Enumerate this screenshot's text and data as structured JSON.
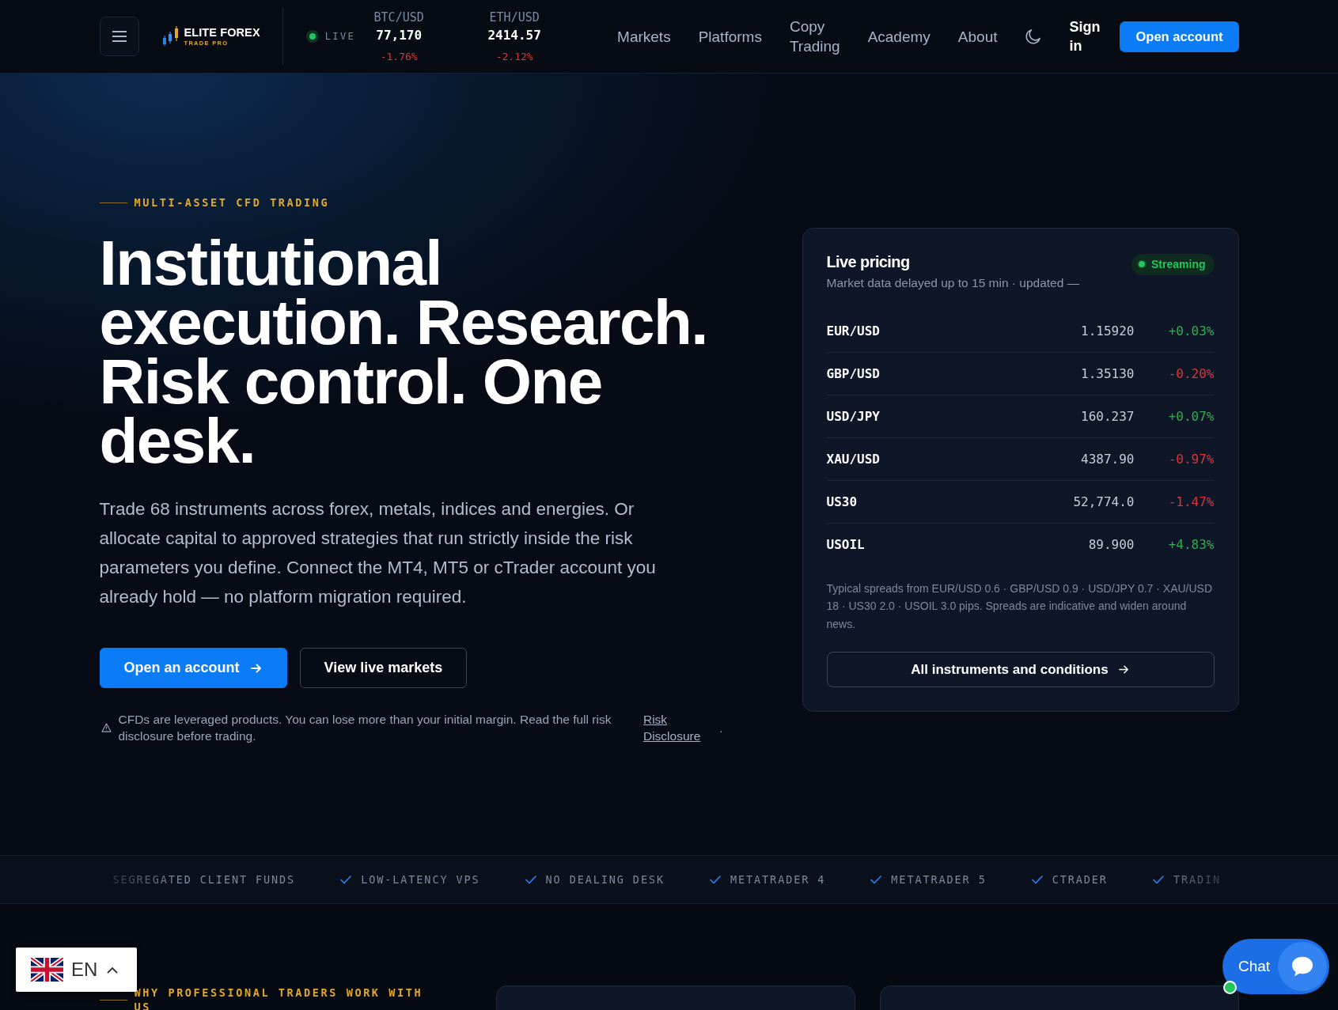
{
  "header": {
    "logo": {
      "name": "ELITE FOREX",
      "tagline": "TRADE PRO"
    },
    "live_label": "LIVE",
    "tickers": [
      {
        "symbol": "BTC/USD",
        "price": "77,170",
        "change": "-1.76%",
        "color": "#dd3535"
      },
      {
        "symbol": "ETH/USD",
        "price": "2414.57",
        "change": "-2.12%",
        "color": "#dd3535"
      }
    ],
    "nav": [
      "Markets",
      "Platforms",
      "Copy Trading",
      "Academy",
      "About"
    ],
    "sign_in": "Sign in",
    "cta": "Open account"
  },
  "hero": {
    "eyebrow": "MULTI-ASSET CFD TRADING",
    "heading": "Institutional execution. Research. Risk control. One desk.",
    "body": "Trade 68 instruments across forex, metals, indices and energies. Or allocate capital to approved strategies that run strictly inside the risk parameters you define. Connect the MT4, MT5 or cTrader account you already hold — no platform migration required.",
    "buttons": [
      {
        "label": "Open an account",
        "kind": "primary"
      },
      {
        "label": "View live markets",
        "kind": "secondary"
      }
    ],
    "disclaimer": {
      "text": "CFDs are leveraged products. You can lose more than your initial margin. Read the full risk disclosure before trading.",
      "link": "Risk Disclosure",
      "trailing": "."
    }
  },
  "pricing": {
    "title": "Live pricing",
    "status": "Streaming",
    "subtitle": "Market data delayed up to 15 min · updated —",
    "rows": [
      {
        "symbol": "EUR/USD",
        "price": "1.15920",
        "change": "+0.03%",
        "color": "#2fae4e"
      },
      {
        "symbol": "GBP/USD",
        "price": "1.35130",
        "change": "-0.20%",
        "color": "#dd3535"
      },
      {
        "symbol": "USD/JPY",
        "price": "160.237",
        "change": "+0.07%",
        "color": "#2fae4e"
      },
      {
        "symbol": "XAU/USD",
        "price": "4387.90",
        "change": "-0.97%",
        "color": "#dd3535"
      },
      {
        "symbol": "US30",
        "price": "52,774.0",
        "change": "-1.47%",
        "color": "#dd3535"
      },
      {
        "symbol": "USOIL",
        "price": "89.900",
        "change": "+4.83%",
        "color": "#2fae4e"
      }
    ],
    "note": "Typical spreads from EUR/USD 0.6 · GBP/USD 0.9 · USD/JPY 0.7 · XAU/USD 18 · US30 2.0 · USOIL 3.0 pips. Spreads are indicative and widen around news.",
    "button": "All instruments and conditions"
  },
  "features": [
    {
      "label": "SEGREGATED CLIENT FUNDS",
      "check": false
    },
    {
      "label": "LOW-LATENCY VPS",
      "check": true
    },
    {
      "label": "NO DEALING DESK",
      "check": true
    },
    {
      "label": "METATRADER 4",
      "check": true
    },
    {
      "label": "METATRADER 5",
      "check": true
    },
    {
      "label": "CTRADER",
      "check": true
    },
    {
      "label": "TRADIN",
      "check": true
    }
  ],
  "why": {
    "eyebrow": "WHY PROFESSIONAL TRADERS WORK WITH US"
  },
  "language": {
    "code": "EN"
  },
  "chat": {
    "label": "Chat",
    "online": true
  }
}
